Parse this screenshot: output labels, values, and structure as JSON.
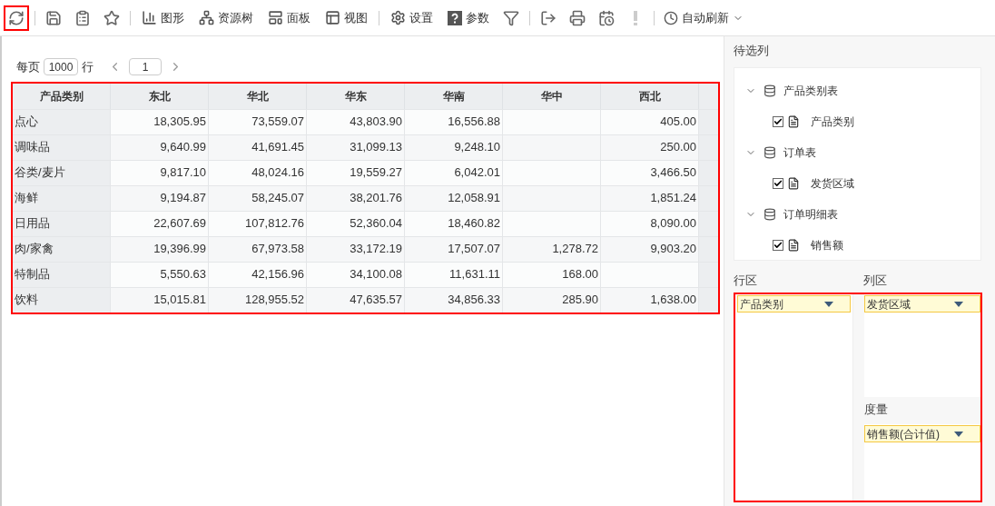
{
  "toolbar": [
    {
      "kind": "icon"
    },
    {
      "kind": "icon"
    },
    {
      "kind": "icon"
    },
    {
      "kind": "icon"
    },
    {
      "kind": "labeled",
      "label": "图形"
    },
    {
      "kind": "labeled",
      "label": "资源树"
    },
    {
      "kind": "labeled",
      "label": "面板"
    },
    {
      "kind": "labeled",
      "label": "视图"
    },
    {
      "kind": "labeled",
      "label": "设置"
    },
    {
      "kind": "labeled",
      "label": "参数"
    },
    {
      "kind": "icon"
    },
    {
      "kind": "icon"
    },
    {
      "kind": "icon"
    },
    {
      "kind": "icon"
    },
    {
      "kind": "icon"
    },
    {
      "kind": "dropdown",
      "label": "自动刷新"
    }
  ],
  "pager": {
    "prefix": "每页",
    "page_size": "1000",
    "suffix": "行",
    "page": "1"
  },
  "table": {
    "columns": [
      "产品类别",
      "东北",
      "华北",
      "华东",
      "华南",
      "华中",
      "西北"
    ],
    "rows": [
      [
        "点心",
        "18,305.95",
        "73,559.07",
        "43,803.90",
        "16,556.88",
        "",
        "405.00"
      ],
      [
        "调味品",
        "9,640.99",
        "41,691.45",
        "31,099.13",
        "9,248.10",
        "",
        "250.00"
      ],
      [
        "谷类/麦片",
        "9,817.10",
        "48,024.16",
        "19,559.27",
        "6,042.01",
        "",
        "3,466.50"
      ],
      [
        "海鲜",
        "9,194.87",
        "58,245.07",
        "38,201.76",
        "12,058.91",
        "",
        "1,851.24"
      ],
      [
        "日用品",
        "22,607.69",
        "107,812.76",
        "52,360.04",
        "18,460.82",
        "",
        "8,090.00"
      ],
      [
        "肉/家禽",
        "19,396.99",
        "67,973.58",
        "33,172.19",
        "17,507.07",
        "1,278.72",
        "9,903.20"
      ],
      [
        "特制品",
        "5,550.63",
        "42,156.96",
        "34,100.08",
        "11,631.11",
        "168.00",
        ""
      ],
      [
        "饮料",
        "15,015.81",
        "128,955.52",
        "47,635.57",
        "34,856.33",
        "285.90",
        "1,638.00"
      ]
    ]
  },
  "candidates": {
    "title": "待选列",
    "tables": [
      {
        "name": "产品类别表",
        "expanded": true,
        "children": [
          {
            "name": "产品类别",
            "checked": true
          }
        ]
      },
      {
        "name": "订单表",
        "expanded": true,
        "children": [
          {
            "name": "发货区域",
            "checked": true
          }
        ]
      },
      {
        "name": "订单明细表",
        "expanded": true,
        "children": [
          {
            "name": "销售额",
            "checked": true
          }
        ]
      }
    ]
  },
  "row_area": {
    "title": "行区",
    "fields": [
      "产品类别"
    ]
  },
  "column_area": {
    "title": "列区",
    "fields": [
      "发货区域"
    ]
  },
  "measure_area": {
    "title": "度量",
    "fields": [
      "销售额(合计值)"
    ]
  }
}
